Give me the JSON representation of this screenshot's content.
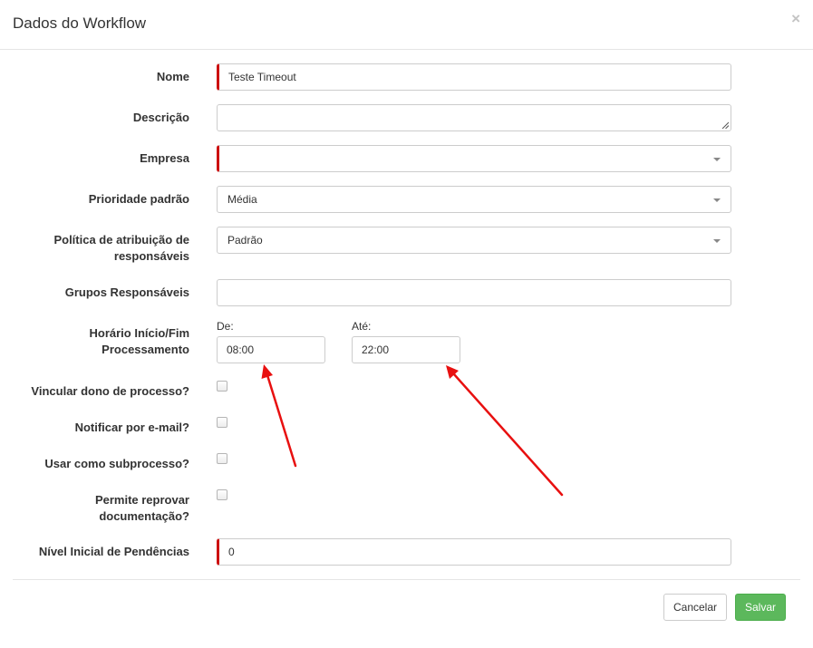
{
  "modal": {
    "title": "Dados do Workflow",
    "close_symbol": "×"
  },
  "form": {
    "nome": {
      "label": "Nome",
      "value": "Teste Timeout"
    },
    "descricao": {
      "label": "Descrição",
      "value": ""
    },
    "empresa": {
      "label": "Empresa",
      "value": ""
    },
    "prioridade": {
      "label": "Prioridade padrão",
      "value": "Média"
    },
    "politica": {
      "label_line1": "Política de atribuição de",
      "label_line2": "responsáveis",
      "value": "Padrão"
    },
    "grupos": {
      "label": "Grupos Responsáveis",
      "value": ""
    },
    "horario": {
      "label_line1": "Horário Início/Fim",
      "label_line2": "Processamento",
      "de_label": "De:",
      "de_value": "08:00",
      "ate_label": "Até:",
      "ate_value": "22:00"
    },
    "vincular": {
      "label": "Vincular dono de processo?",
      "checked": false
    },
    "notificar": {
      "label": "Notificar por e-mail?",
      "checked": false
    },
    "subprocesso": {
      "label": "Usar como subprocesso?",
      "checked": false
    },
    "reprovar": {
      "label_line1": "Permite reprovar",
      "label_line2": "documentação?",
      "checked": false
    },
    "nivel": {
      "label": "Nível Inicial de Pendências",
      "value": "0"
    }
  },
  "footer": {
    "cancel_label": "Cancelar",
    "save_label": "Salvar"
  },
  "colors": {
    "required_marker": "#cc1111",
    "save_button": "#5cb85c",
    "annotation_arrow": "#e81010"
  }
}
